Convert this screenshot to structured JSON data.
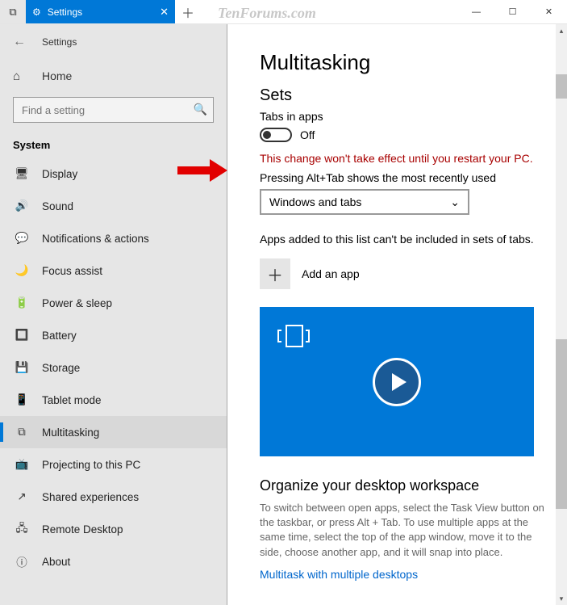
{
  "titlebar": {
    "tab_label": "Settings",
    "watermark": "TenForums.com"
  },
  "sidebar": {
    "app_title": "Settings",
    "home_label": "Home",
    "search_placeholder": "Find a setting",
    "group_label": "System",
    "items": [
      {
        "icon": "🖥",
        "label": "Display"
      },
      {
        "icon": "🔊",
        "label": "Sound"
      },
      {
        "icon": "💬",
        "label": "Notifications & actions"
      },
      {
        "icon": "🌙",
        "label": "Focus assist"
      },
      {
        "icon": "🔋",
        "label": "Power & sleep"
      },
      {
        "icon": "🔲",
        "label": "Battery"
      },
      {
        "icon": "💾",
        "label": "Storage"
      },
      {
        "icon": "📱",
        "label": "Tablet mode"
      },
      {
        "icon": "⧉",
        "label": "Multitasking",
        "active": true
      },
      {
        "icon": "📺",
        "label": "Projecting to this PC"
      },
      {
        "icon": "↗",
        "label": "Shared experiences"
      },
      {
        "icon": "🖧",
        "label": "Remote Desktop"
      },
      {
        "icon": "ⓘ",
        "label": "About"
      }
    ]
  },
  "main": {
    "title": "Multitasking",
    "sets_heading": "Sets",
    "tabs_label": "Tabs in apps",
    "toggle_state": "Off",
    "warning": "This change won't take effect until you restart your PC.",
    "alttab_label": "Pressing Alt+Tab shows the most recently used",
    "alttab_value": "Windows and tabs",
    "apps_info": "Apps added to this list can't be included in sets of tabs.",
    "add_label": "Add an app",
    "workspace_heading": "Organize your desktop workspace",
    "workspace_desc": "To switch between open apps, select the Task View button on the taskbar, or press Alt + Tab. To use multiple apps at the same time, select the top of the app window, move it to the side, choose another app, and it will snap into place.",
    "workspace_link": "Multitask with multiple desktops"
  }
}
